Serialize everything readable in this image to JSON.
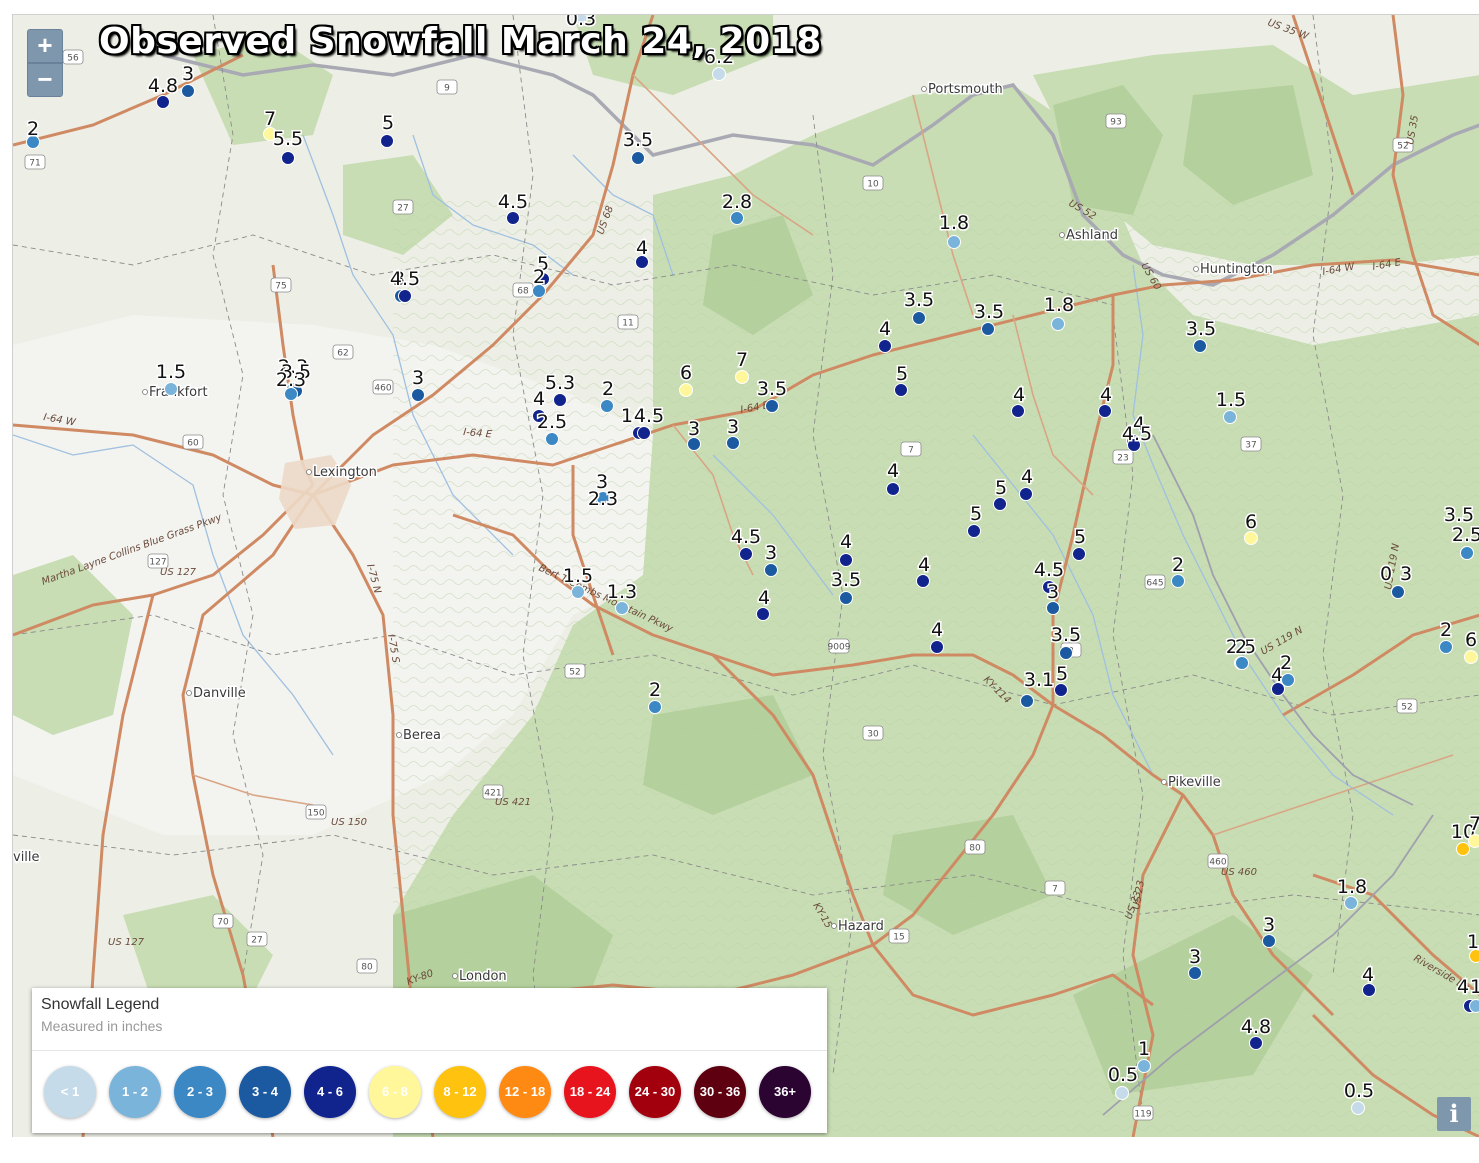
{
  "title": "Observed Snowfall March 24, 2018",
  "zoom": {
    "in_label": "+",
    "out_label": "−"
  },
  "info_label": "i",
  "legend": {
    "title": "Snowfall Legend",
    "subtitle": "Measured in inches",
    "items": [
      {
        "label": "< 1",
        "color": "#c5dbe9"
      },
      {
        "label": "1 - 2",
        "color": "#7ab4da"
      },
      {
        "label": "2 - 3",
        "color": "#3b88c4"
      },
      {
        "label": "3 - 4",
        "color": "#1b5aa0"
      },
      {
        "label": "4 - 6",
        "color": "#11238c"
      },
      {
        "label": "6 - 8",
        "color": "#fff79a"
      },
      {
        "label": "8 - 12",
        "color": "#ffc20e"
      },
      {
        "label": "12 - 18",
        "color": "#ff8a13"
      },
      {
        "label": "18 - 24",
        "color": "#e8141d"
      },
      {
        "label": "24 - 30",
        "color": "#a3000e"
      },
      {
        "label": "30 - 36",
        "color": "#5e0010"
      },
      {
        "label": "36+",
        "color": "#2c0432"
      }
    ]
  },
  "places": [
    "Portsmouth",
    "Ashland",
    "Huntington",
    "Frankfort",
    "Lexington",
    "Danville",
    "Berea",
    "London",
    "Hazard",
    "Pikeville",
    "ville"
  ],
  "route_labels": [
    "US 35 W",
    "US 52",
    "US 60",
    "I-64 W",
    "I-64 E",
    "I-64 E",
    "I-64 E",
    "I-64 W",
    "US 68",
    "KY-80",
    "KY-15",
    "US 119 N",
    "US 119 N",
    "US 23",
    "Riverside Dr",
    "Martha Layne Collins Blue Grass Pkwy",
    "Bert T Combs Mountain Pkwy",
    "KY-114",
    "I-75 N",
    "I-75 S",
    "US 421",
    "US 127",
    "US 127",
    "US 150",
    "US 460",
    "US 23",
    "US 35"
  ],
  "shields": [
    "56",
    "9",
    "71",
    "75",
    "27",
    "68",
    "62",
    "460",
    "60",
    "127",
    "11",
    "10",
    "93",
    "52",
    "37",
    "23",
    "645",
    "7",
    "9009",
    "30",
    "3",
    "52",
    "421",
    "150",
    "70",
    "27",
    "80",
    "80",
    "7",
    "460",
    "15",
    "52",
    "119"
  ],
  "observations": [
    {
      "v": "2",
      "c": "#3b88c4"
    },
    {
      "v": "4.8",
      "c": "#11238c"
    },
    {
      "v": "3",
      "c": "#1b5aa0"
    },
    {
      "v": "7",
      "c": "#fff79a"
    },
    {
      "v": "5.5",
      "c": "#11238c"
    },
    {
      "v": "5",
      "c": "#11238c"
    },
    {
      "v": "4.5",
      "c": "#11238c"
    },
    {
      "v": "0.3",
      "c": "#c5dbe9"
    },
    {
      "v": "6.2",
      "c": "#c5dbe9"
    },
    {
      "v": "3.5",
      "c": "#1b5aa0"
    },
    {
      "v": "2.8",
      "c": "#3b88c4"
    },
    {
      "v": "5",
      "c": "#11238c"
    },
    {
      "v": "2",
      "c": "#3b88c4"
    },
    {
      "v": "4",
      "c": "#11238c"
    },
    {
      "v": "3",
      "c": "#1b5aa0"
    },
    {
      "v": "4.5",
      "c": "#11238c"
    },
    {
      "v": "1.5",
      "c": "#7ab4da"
    },
    {
      "v": "2.3",
      "c": "#3b88c4"
    },
    {
      "v": "3.5",
      "c": "#1b5aa0"
    },
    {
      "v": "2.3",
      "c": "#3b88c4"
    },
    {
      "v": "3",
      "c": "#1b5aa0"
    },
    {
      "v": "5.3",
      "c": "#11238c"
    },
    {
      "v": "4",
      "c": "#11238c"
    },
    {
      "v": "2.5",
      "c": "#3b88c4"
    },
    {
      "v": "2",
      "c": "#3b88c4"
    },
    {
      "v": "14",
      "c": "#11238c"
    },
    {
      "v": "4.5",
      "c": "#11238c"
    },
    {
      "v": "6",
      "c": "#fff79a"
    },
    {
      "v": "7",
      "c": "#fff79a"
    },
    {
      "v": "3",
      "c": "#1b5aa0"
    },
    {
      "v": "3",
      "c": "#1b5aa0"
    },
    {
      "v": "3.5",
      "c": "#1b5aa0"
    },
    {
      "v": "3",
      "c": "#1b5aa0"
    },
    {
      "v": "2.3",
      "c": "#3b88c4"
    },
    {
      "v": "1.5",
      "c": "#7ab4da"
    },
    {
      "v": "1.3",
      "c": "#7ab4da"
    },
    {
      "v": "4.5",
      "c": "#11238c"
    },
    {
      "v": "3",
      "c": "#1b5aa0"
    },
    {
      "v": "4",
      "c": "#11238c"
    },
    {
      "v": "4",
      "c": "#11238c"
    },
    {
      "v": "3.5",
      "c": "#1b5aa0"
    },
    {
      "v": "2",
      "c": "#3b88c4"
    },
    {
      "v": "1.8",
      "c": "#7ab4da"
    },
    {
      "v": "3.5",
      "c": "#1b5aa0"
    },
    {
      "v": "4",
      "c": "#11238c"
    },
    {
      "v": "5",
      "c": "#11238c"
    },
    {
      "v": "3.5",
      "c": "#1b5aa0"
    },
    {
      "v": "1.8",
      "c": "#7ab4da"
    },
    {
      "v": "3.5",
      "c": "#1b5aa0"
    },
    {
      "v": "1.5",
      "c": "#7ab4da"
    },
    {
      "v": "4",
      "c": "#11238c"
    },
    {
      "v": "4",
      "c": "#11238c"
    },
    {
      "v": "4",
      "c": "#11238c"
    },
    {
      "v": "4.5",
      "c": "#11238c"
    },
    {
      "v": "4",
      "c": "#11238c"
    },
    {
      "v": "5",
      "c": "#11238c"
    },
    {
      "v": "4",
      "c": "#11238c"
    },
    {
      "v": "5",
      "c": "#11238c"
    },
    {
      "v": "4",
      "c": "#11238c"
    },
    {
      "v": "5",
      "c": "#11238c"
    },
    {
      "v": "4.5",
      "c": "#11238c"
    },
    {
      "v": "3",
      "c": "#1b5aa0"
    },
    {
      "v": "4",
      "c": "#11238c"
    },
    {
      "v": "3.5",
      "c": "#1b5aa0"
    },
    {
      "v": "3.1",
      "c": "#1b5aa0"
    },
    {
      "v": "5",
      "c": "#11238c"
    },
    {
      "v": "2",
      "c": "#3b88c4"
    },
    {
      "v": "6",
      "c": "#fff79a"
    },
    {
      "v": "3.5",
      "c": "#1b5aa0"
    },
    {
      "v": "2.5",
      "c": "#3b88c4"
    },
    {
      "v": "0",
      "c": "#1b5aa0"
    },
    {
      "v": "3",
      "c": "#1b5aa0"
    },
    {
      "v": "2",
      "c": "#3b88c4"
    },
    {
      "v": "6",
      "c": "#fff79a"
    },
    {
      "v": "2.5",
      "c": "#3b88c4"
    },
    {
      "v": "4",
      "c": "#11238c"
    },
    {
      "v": "2",
      "c": "#3b88c4"
    },
    {
      "v": "2",
      "c": "#3b88c4"
    },
    {
      "v": "10",
      "c": "#ffc20e"
    },
    {
      "v": "7",
      "c": "#fff79a"
    },
    {
      "v": "1.8",
      "c": "#7ab4da"
    },
    {
      "v": "3",
      "c": "#1b5aa0"
    },
    {
      "v": "3",
      "c": "#1b5aa0"
    },
    {
      "v": "4",
      "c": "#11238c"
    },
    {
      "v": "1",
      "c": "#7ab4da"
    },
    {
      "v": "4",
      "c": "#11238c"
    },
    {
      "v": "1",
      "c": "#ffc20e"
    },
    {
      "v": "4.8",
      "c": "#11238c"
    },
    {
      "v": "1",
      "c": "#7ab4da"
    },
    {
      "v": "0.5",
      "c": "#c5dbe9"
    },
    {
      "v": "0.5",
      "c": "#c5dbe9"
    }
  ]
}
